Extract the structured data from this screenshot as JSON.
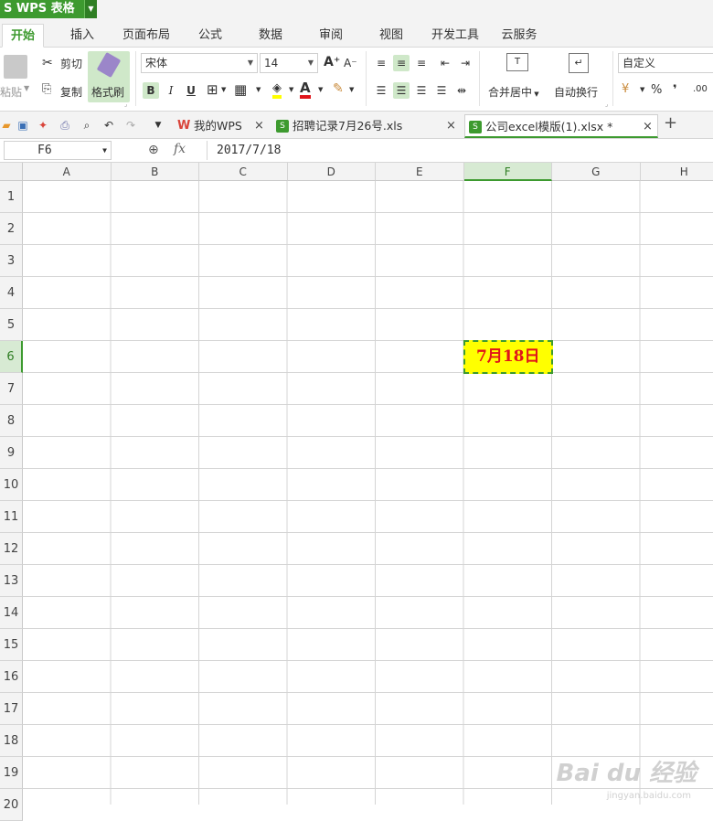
{
  "app": {
    "name": "WPS 表格"
  },
  "menu": [
    "开始",
    "插入",
    "页面布局",
    "公式",
    "数据",
    "审阅",
    "视图",
    "开发工具",
    "云服务"
  ],
  "ribbon": {
    "paste": "粘贴",
    "cut": "剪切",
    "copy": "复制",
    "format_painter": "格式刷",
    "font_name": "宋体",
    "font_size": "14",
    "bold": "B",
    "italic": "I",
    "underline": "U",
    "font_grow": "A⁺",
    "font_shrink": "A⁻",
    "font_color_letter": "A",
    "merge_center": "合并居中",
    "wrap_text": "自动换行",
    "number_format": "自定义",
    "percent": "%",
    "comma": "❜",
    "decimal": ".00"
  },
  "doc_tabs": [
    {
      "label": "我的WPS"
    },
    {
      "label": "招聘记录7月26号.xls"
    },
    {
      "label": "公司excel模版(1).xlsx *"
    }
  ],
  "formula_bar": {
    "cell_ref": "F6",
    "fx": "fx",
    "value": "2017/7/18"
  },
  "columns": [
    "A",
    "B",
    "C",
    "D",
    "E",
    "F",
    "G",
    "H"
  ],
  "rows": [
    "1",
    "2",
    "3",
    "4",
    "5",
    "6",
    "7",
    "8",
    "9",
    "10",
    "11",
    "12",
    "13",
    "14",
    "15",
    "16",
    "17",
    "18",
    "19",
    "20"
  ],
  "selected": {
    "column": "F",
    "row": "6",
    "display": "7月18日"
  },
  "watermark": {
    "main": "Bai du 经验",
    "sub": "jingyan.baidu.com"
  },
  "colors": {
    "accent": "#3d9a2f",
    "cell_fill": "#ffff00",
    "cell_text": "#e0141a"
  }
}
